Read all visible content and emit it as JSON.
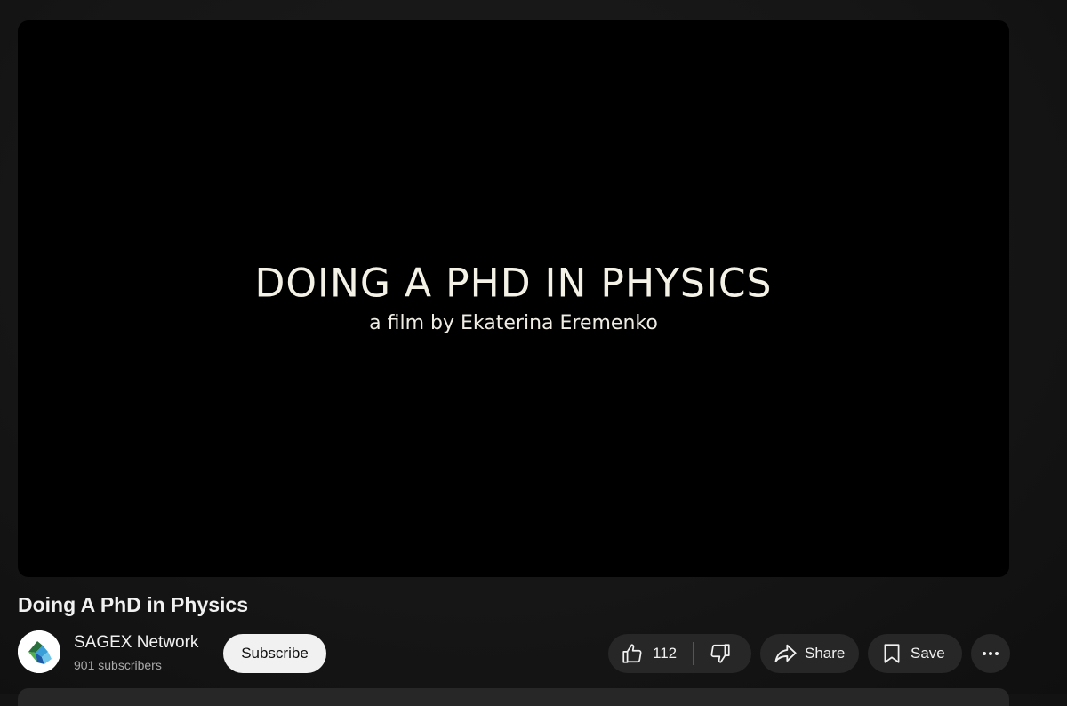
{
  "player": {
    "frame_title": "DOING A PHD IN PHYSICS",
    "frame_subtitle": "a film by Ekaterina Eremenko"
  },
  "video": {
    "title": "Doing A PhD in Physics"
  },
  "channel": {
    "name": "SAGEX Network",
    "subscribers": "901 subscribers",
    "avatar_icon": "sagex-logo-icon"
  },
  "actions": {
    "subscribe_label": "Subscribe",
    "like_count": "112",
    "share_label": "Share",
    "save_label": "Save"
  },
  "colors": {
    "background": "#0f0f0f",
    "pill": "#272727",
    "subscribe_bg": "#f1f1f1",
    "text": "#f1f1f1",
    "secondary_text": "#aaaaaa"
  }
}
